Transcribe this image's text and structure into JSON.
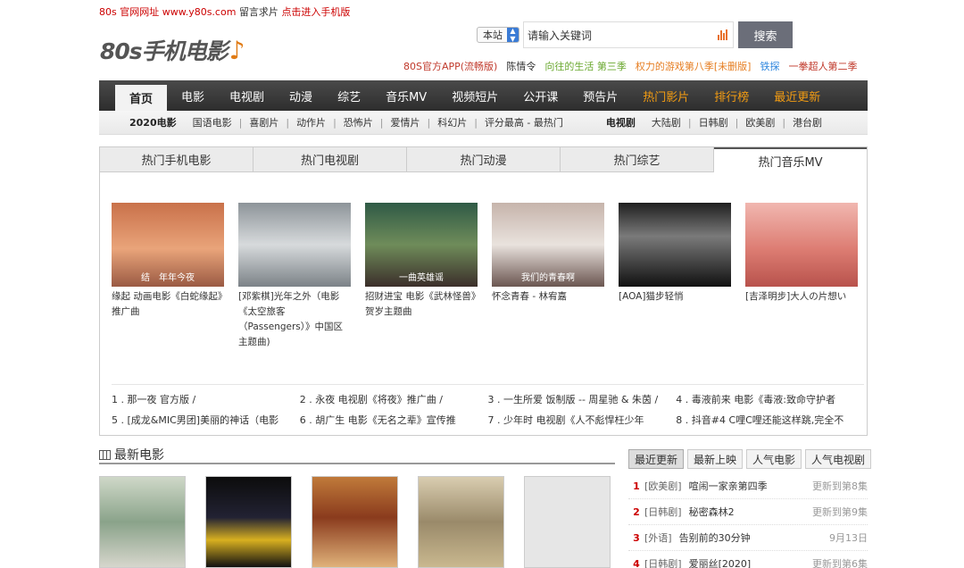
{
  "topbar": {
    "site": "80s 官网网址 www.y80s.com",
    "message": "留言求片",
    "mobile": "点击进入手机版"
  },
  "logo": {
    "text": "80s手机电影",
    "note": "♪"
  },
  "search": {
    "scope": "本站",
    "placeholder": "请输入关键词",
    "button": "搜索"
  },
  "promo": [
    {
      "text": "80S官方APP(流畅版)",
      "color": "#c0392b"
    },
    {
      "text": "陈情令",
      "color": "#333333"
    },
    {
      "text": "向往的生活 第三季",
      "color": "#6aa82f"
    },
    {
      "text": "权力的游戏第八季[未删版]",
      "color": "#e67e22"
    },
    {
      "text": "铁探",
      "color": "#2e86de"
    },
    {
      "text": "一拳超人第二季",
      "color": "#c0392b"
    }
  ],
  "nav": [
    {
      "label": "首页",
      "active": true
    },
    {
      "label": "电影"
    },
    {
      "label": "电视剧"
    },
    {
      "label": "动漫"
    },
    {
      "label": "综艺"
    },
    {
      "label": "音乐MV"
    },
    {
      "label": "视频短片"
    },
    {
      "label": "公开课"
    },
    {
      "label": "预告片"
    },
    {
      "label": "热门影片",
      "hot": true
    },
    {
      "label": "排行榜",
      "hot": true
    },
    {
      "label": "最近更新",
      "hot": true
    }
  ],
  "subnav": {
    "movie_head": "2020电影",
    "movie_links": [
      "国语电影",
      "喜剧片",
      "动作片",
      "恐怖片",
      "爱情片",
      "科幻片"
    ],
    "sort_links": "评分最高 - 最热门",
    "tv_head": "电视剧",
    "tv_links": [
      "大陆剧",
      "日韩剧",
      "欧美剧",
      "港台剧"
    ]
  },
  "hot_tabs": [
    {
      "label": "热门手机电影"
    },
    {
      "label": "热门电视剧"
    },
    {
      "label": "热门动漫"
    },
    {
      "label": "热门综艺"
    },
    {
      "label": "热门音乐MV",
      "active": true
    }
  ],
  "mv_cards": [
    {
      "title": "缘起 动画电影《白蛇缘起》推广曲",
      "caption": "结　年年今夜",
      "bg": "linear-gradient(#c9714a, #e9a47a 55%, #9a5a43)"
    },
    {
      "title": "[邓紫棋]光年之外（电影《太空旅客（Passengers）》中国区主题曲)",
      "caption": "",
      "bg": "linear-gradient(#8d9499, #d7dadc 50%, #7b8287)"
    },
    {
      "title": "招财进宝 电影《武林怪兽》贺岁主题曲",
      "caption": "一曲英雄谣",
      "bg": "linear-gradient(#2f5a46, #6f8c5a 50%, #3b2e2a)"
    },
    {
      "title": "怀念青春 - 林宥嘉",
      "caption": "我们的青春啊",
      "bg": "linear-gradient(#c6b4ab, #e9e2dd 50%, #6b5650)"
    },
    {
      "title": "[AOA]猫步轻悄",
      "caption": "",
      "bg": "linear-gradient(#1f1f1f, #7a7a7a 40%, #111)"
    },
    {
      "title": "[吉泽明步]大人の片想い",
      "caption": "",
      "bg": "linear-gradient(#f1b7b0, #dd7d73 55%, #b8524c)"
    }
  ],
  "rank_rows": [
    [
      "1 . 那一夜 官方版 /",
      "2 . 永夜 电视剧《将夜》推广曲 /",
      "3 . 一生所爱 饭制版 -- 周星驰 & 朱茵 /",
      "4 . 毒液前来 电影《毒液:致命守护者"
    ],
    [
      "5 . [成龙&MIC男团]美丽的神话（电影",
      "6 . 胡广生 电影《无名之辈》宣传推",
      "7 . 少年时 电视剧《人不彪悍枉少年",
      "8 . 抖音#4 C哩C哩还能这样跳,完全不"
    ]
  ],
  "latest_movies": {
    "title": "最新电影",
    "posters": [
      {
        "bg": "linear-gradient(#cfd8c8, #8aa38a 50%, #d6d6cc)"
      },
      {
        "bg": "linear-gradient(#0c0c0c, #223 45%, #d8b020 70%, #111)"
      },
      {
        "bg": "linear-gradient(#c07a3a, #8a3b1d 45%, #e0b27a)"
      },
      {
        "bg": "linear-gradient(#d9cdb0, #9a8a6a 50%, #c9b88f)"
      },
      {
        "bg": "linear-gradient(#e6e6e6, #e6e6e6)"
      }
    ]
  },
  "side_tabs": [
    {
      "label": "最近更新",
      "active": true
    },
    {
      "label": "最新上映"
    },
    {
      "label": "人气电影"
    },
    {
      "label": "人气电视剧"
    }
  ],
  "side_list": [
    {
      "idx": "1",
      "cat": "[欧美剧]",
      "name": "喧闹一家亲第四季",
      "upd": "更新到第8集"
    },
    {
      "idx": "2",
      "cat": "[日韩剧]",
      "name": "秘密森林2",
      "upd": "更新到第9集"
    },
    {
      "idx": "3",
      "cat": "[外语]",
      "name": "告别前的30分钟",
      "upd": "9月13日"
    },
    {
      "idx": "4",
      "cat": "[日韩剧]",
      "name": "爱丽丝[2020]",
      "upd": "更新到第6集"
    }
  ]
}
